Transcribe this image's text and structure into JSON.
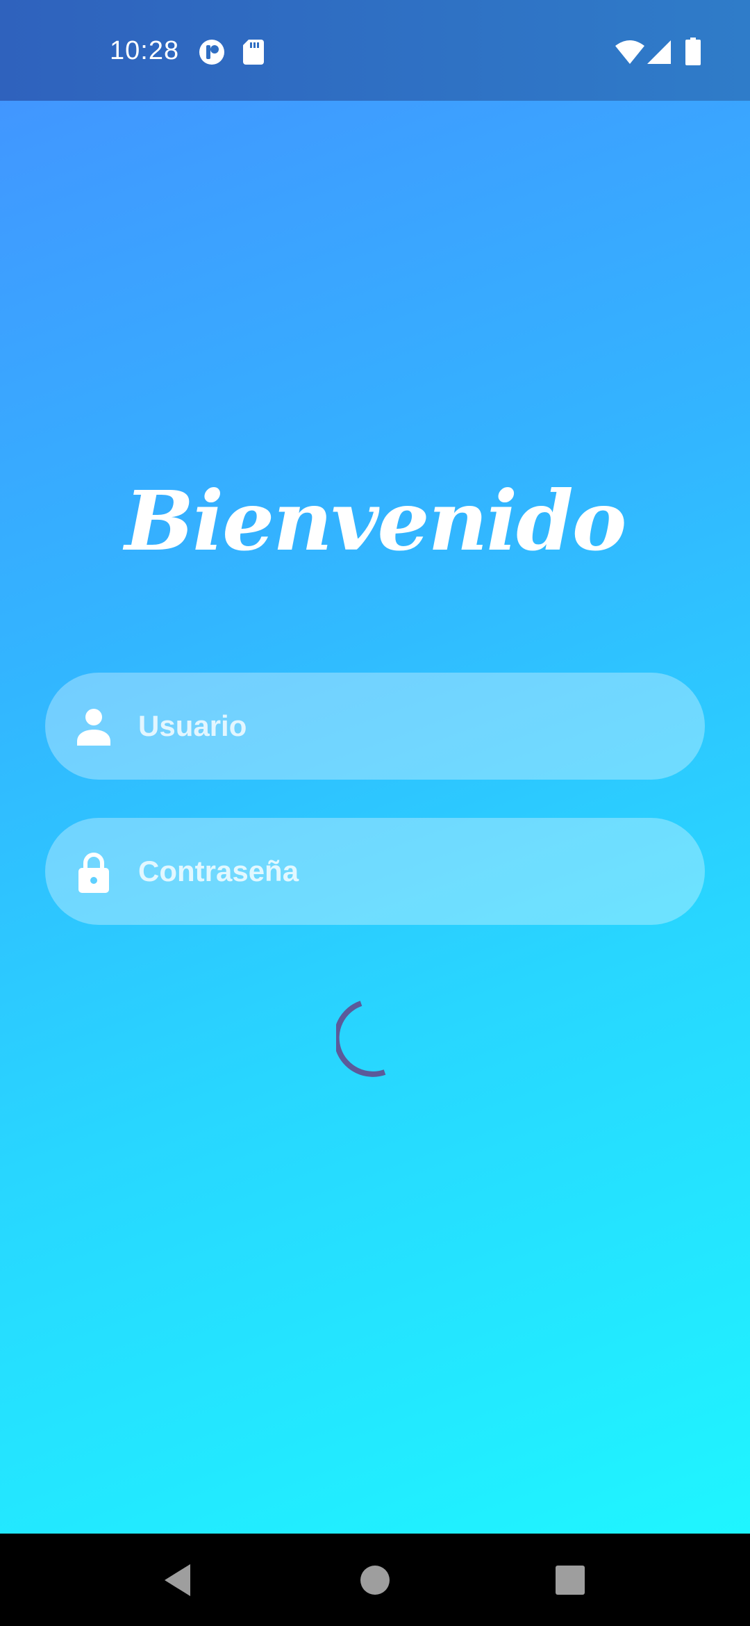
{
  "status_bar": {
    "time": "10:28",
    "left_icons": [
      "app-notification-icon",
      "sd-card-icon"
    ],
    "right_icons": [
      "wifi-icon",
      "cell-signal-icon",
      "battery-icon"
    ]
  },
  "login": {
    "title": "Bienvenido",
    "username": {
      "placeholder": "Usuario",
      "value": "",
      "icon": "person-icon"
    },
    "password": {
      "placeholder": "Contraseña",
      "value": "",
      "icon": "lock-icon"
    },
    "loading": true
  },
  "navigation_bar": {
    "buttons": [
      "back-icon",
      "home-icon",
      "recents-icon"
    ]
  },
  "colors": {
    "gradient_top": "#4491ff",
    "gradient_bottom": "#1dfaff",
    "status_bar": "#2f6ec3",
    "spinner": "#5b5a9a",
    "text": "#ffffff"
  }
}
